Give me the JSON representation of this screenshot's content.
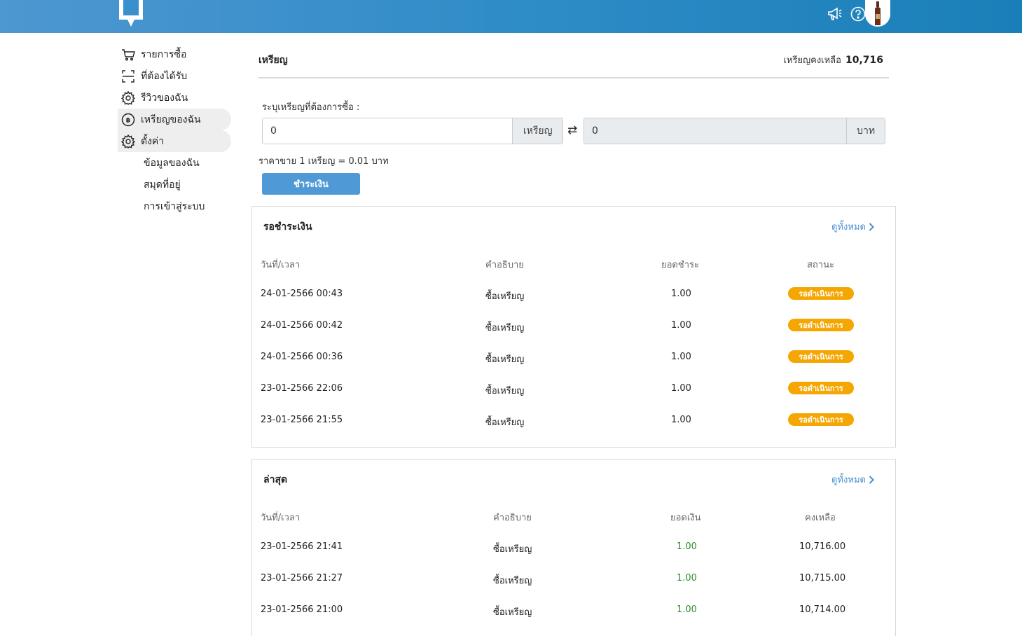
{
  "header": {
    "icons": [
      "megaphone-icon",
      "help-icon",
      "bell-icon"
    ],
    "brand_color": "#2f8cc7"
  },
  "sidebar": {
    "items": [
      {
        "label": "รายการซื้อ",
        "icon": "cart-icon"
      },
      {
        "label": "ที่ต้องได้รับ",
        "icon": "scan-icon"
      },
      {
        "label": "รีวิวของฉัน",
        "icon": "gear-icon"
      },
      {
        "label": "เหรียญของฉัน",
        "icon": "coin-icon",
        "active": true
      },
      {
        "label": "ตั้งค่า",
        "icon": "gear-icon",
        "active": true
      }
    ],
    "sub_items": [
      {
        "label": "ข้อมูลของฉัน"
      },
      {
        "label": "สมุดที่อยู่"
      },
      {
        "label": "การเข้าสู่ระบบ"
      }
    ]
  },
  "main": {
    "title": "เหรียญ",
    "balance_label": "เหรียญคงเหลือ",
    "balance_value": "10,716",
    "buy_label": "ระบุเหรียญที่ต้องการซื้อ :",
    "coin_input_value": "0",
    "coin_unit": "เหรียญ",
    "baht_input_value": "0",
    "baht_unit": "บาท",
    "rate_text": "ราคาขาย 1 เหรียญ = 0.01 บาท",
    "pay_button": "ชำระเงิน"
  },
  "pending": {
    "title": "รอชำระเงิน",
    "view_all": "ดูทั้งหมด",
    "columns": [
      "วันที่/เวลา",
      "คำอธิบาย",
      "ยอดชำระ",
      "สถานะ"
    ],
    "rows": [
      {
        "date": "24-01-2566 00:43",
        "desc": "ซื้อเหรียญ",
        "amount": "1.00",
        "status": "รอดำเนินการ"
      },
      {
        "date": "24-01-2566 00:42",
        "desc": "ซื้อเหรียญ",
        "amount": "1.00",
        "status": "รอดำเนินการ"
      },
      {
        "date": "24-01-2566 00:36",
        "desc": "ซื้อเหรียญ",
        "amount": "1.00",
        "status": "รอดำเนินการ"
      },
      {
        "date": "23-01-2566 22:06",
        "desc": "ซื้อเหรียญ",
        "amount": "1.00",
        "status": "รอดำเนินการ"
      },
      {
        "date": "23-01-2566 21:55",
        "desc": "ซื้อเหรียญ",
        "amount": "1.00",
        "status": "รอดำเนินการ"
      }
    ],
    "status_color": "#f5a600"
  },
  "latest": {
    "title": "ล่าสุด",
    "view_all": "ดูทั้งหมด",
    "columns": [
      "วันที่/เวลา",
      "คำอธิบาย",
      "ยอดเงิน",
      "คงเหลือ"
    ],
    "rows": [
      {
        "date": "23-01-2566 21:41",
        "desc": "ซื้อเหรียญ",
        "amount": "1.00",
        "balance": "10,716.00"
      },
      {
        "date": "23-01-2566 21:27",
        "desc": "ซื้อเหรียญ",
        "amount": "1.00",
        "balance": "10,715.00"
      },
      {
        "date": "23-01-2566 21:00",
        "desc": "ซื้อเหรียญ",
        "amount": "1.00",
        "balance": "10,714.00"
      }
    ],
    "amount_color": "#2e8b2e"
  }
}
